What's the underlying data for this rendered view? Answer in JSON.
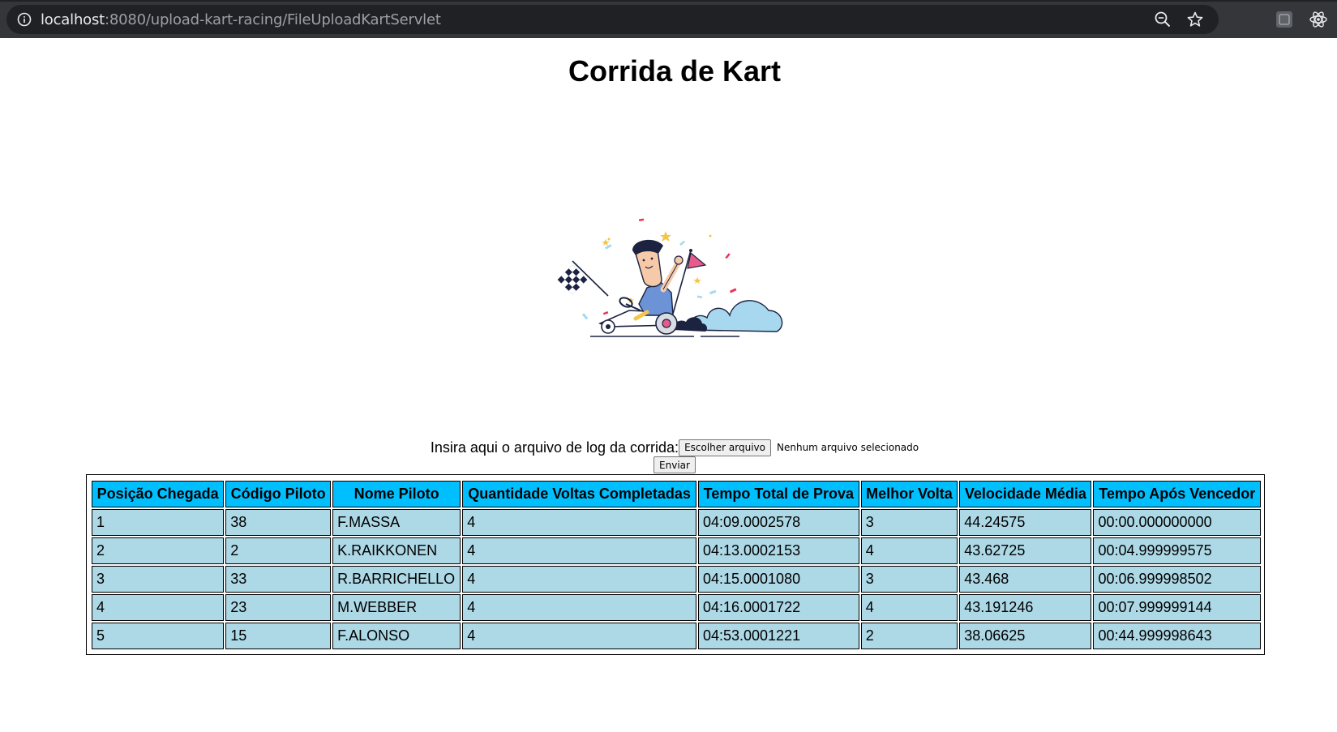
{
  "browser": {
    "url_host": "localhost",
    "url_path": ":8080/upload-kart-racing/FileUploadKartServlet"
  },
  "page": {
    "title": "Corrida de Kart"
  },
  "upload": {
    "label": "Insira aqui o arquivo de log da corrida:",
    "choose_button": "Escolher arquivo",
    "file_status": "Nenhum arquivo selecionado",
    "submit_button": "Enviar"
  },
  "table": {
    "headers": [
      "Posição Chegada",
      "Código Piloto",
      "Nome Piloto",
      "Quantidade Voltas Completadas",
      "Tempo Total de Prova",
      "Melhor Volta",
      "Velocidade Média",
      "Tempo Após Vencedor"
    ],
    "rows": [
      [
        "1",
        "38",
        "F.MASSA",
        "4",
        "04:09.0002578",
        "3",
        "44.24575",
        "00:00.000000000"
      ],
      [
        "2",
        "2",
        "K.RAIKKONEN",
        "4",
        "04:13.0002153",
        "4",
        "43.62725",
        "00:04.999999575"
      ],
      [
        "3",
        "33",
        "R.BARRICHELLO",
        "4",
        "04:15.0001080",
        "3",
        "43.468",
        "00:06.999998502"
      ],
      [
        "4",
        "23",
        "M.WEBBER",
        "4",
        "04:16.0001722",
        "4",
        "43.191246",
        "00:07.999999144"
      ],
      [
        "5",
        "15",
        "F.ALONSO",
        "4",
        "04:53.0001221",
        "2",
        "38.06625",
        "00:44.999998643"
      ]
    ]
  },
  "colors": {
    "header_bg": "#00bfff",
    "cell_bg": "#add8e6",
    "chrome_bg": "#35363a",
    "omnibox_bg": "#202124"
  }
}
